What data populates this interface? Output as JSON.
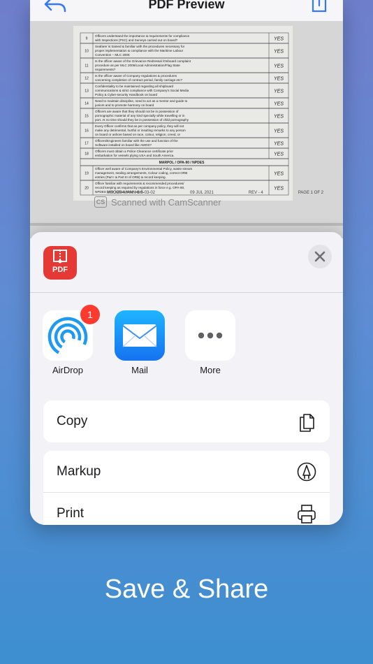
{
  "header": {
    "title": "PDF Preview"
  },
  "document": {
    "rows": [
      {
        "no": "9",
        "text": "Officers understand the importance & requirements for compliance with Inspections (PSC) and Surveys carried out on board?",
        "answer": "YES"
      },
      {
        "no": "10",
        "text": "Seafarer is trained & familiar with the procedures necessary for proper implementation & compliance with the Maritime Labour Convention – MLC 2006",
        "answer": "YES"
      },
      {
        "no": "11",
        "text": "Is the officer aware of the Grievance Redressal /Onboard complaint procedure as per MLC 2006/Local Administration/Flag State requirements?",
        "answer": "YES"
      },
      {
        "no": "12",
        "text": "Is the officer aware of Company regulations & procedures concerning completion of contract period, family carriage etc?",
        "answer": "YES"
      },
      {
        "no": "13",
        "text": "Confidentiality to be maintained regarding all shipboard communications & strict compliance with Company's Social Media Policy & Cyber-security Handbook on board",
        "answer": "YES"
      },
      {
        "no": "14",
        "text": "Need to maintain discipline, need to act as a mentor and guide to juniors and to promote harmony on board",
        "answer": "YES"
      },
      {
        "no": "15",
        "text": "Officers are aware that they should not be in possession of pornographic material of any kind specially while travelling or in port. At no time should they be in possession of child pornography which is illegal and punishable by law",
        "answer": "YES"
      },
      {
        "no": "16",
        "text": "Every Officer confirms that as per company policy, they will not make any detrimental, hurtful or insulting remarks to any person on board or ashore based on race, colour, religion, creed, or national origin.",
        "answer": "YES"
      },
      {
        "no": "17",
        "text": "Officers/Engineers familiar with the use and function of the Software installed on board like AMOS?",
        "answer": "YES"
      },
      {
        "no": "18",
        "text": "Officers must obtain a Police Clearance certificate prior embarkation for vessels plying USA and South America.",
        "answer": "YES"
      }
    ],
    "section_heading": "MARPOL / OPA-90 / NPDES",
    "rows2": [
      {
        "no": "19",
        "text": "Officer well aware of Company's Environmental Policy, waste stream management, sealing arrangements, Colour coding, correct ORB entries (Part I & Part III of ORB) & record keeping.",
        "answer": "YES"
      },
      {
        "no": "20",
        "text": "Officer familiar with requirements & recommended procedures/ record keeping as required by regulations in force e.g. OPA-90, NPDES VGP, Ballast Water Mgmt.",
        "answer": "YES"
      }
    ],
    "footer": {
      "code": "MSCCS-MANN-8.5-03-02",
      "date": "09 JUL 2021",
      "rev": "REV - 4",
      "page": "PAGE 1 OF 2"
    },
    "watermark_badge": "CS",
    "watermark_text": "Scanned with CamScanner"
  },
  "share_sheet": {
    "app_icon_label": "PDF",
    "targets": [
      {
        "label": "AirDrop",
        "badge": "1"
      },
      {
        "label": "Mail"
      },
      {
        "label": "More"
      }
    ],
    "actions": [
      {
        "label": "Copy"
      },
      {
        "label": "Markup"
      },
      {
        "label": "Print"
      }
    ]
  },
  "caption": "Save & Share",
  "colors": {
    "accent": "#1e9bf0",
    "badge": "#ff3b30",
    "app_icon": "#e53935"
  }
}
